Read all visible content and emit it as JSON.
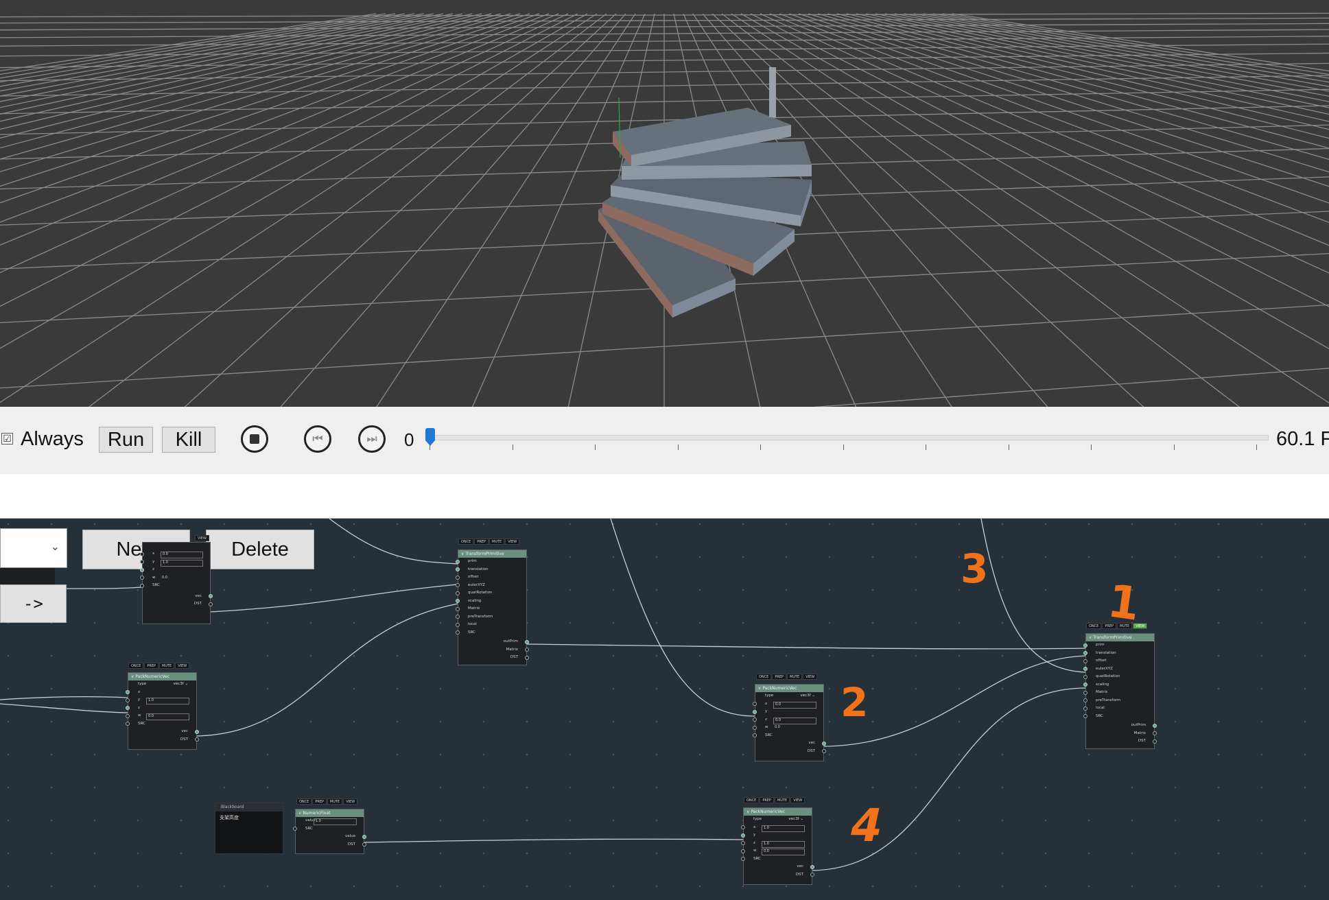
{
  "timeline": {
    "always_checked": "☑",
    "always_label": "Always",
    "run_label": "Run",
    "kill_label": "Kill",
    "frame": "0",
    "fps": "60.1 F"
  },
  "toolbar": {
    "select_value": "",
    "arrow_label": "->",
    "new_label": "New",
    "delete_label": "Delete"
  },
  "tags": [
    "ONCE",
    "PREP",
    "MUTE",
    "VIEW"
  ],
  "nodes": {
    "tp1": {
      "title": "TransformPrimitive",
      "inputs": [
        "prim",
        "translation",
        "offset",
        "eulerXYZ",
        "quatRotation",
        "scaling",
        "Matrix",
        "preTransform",
        "local",
        "SRC"
      ],
      "outputs": [
        "outPrim",
        "Matrix",
        "DST"
      ]
    },
    "tp2": {
      "title": "TransformPrimitive",
      "inputs": [
        "prim",
        "translation",
        "offset",
        "eulerXYZ",
        "quatRotation",
        "scaling",
        "Matrix",
        "preTransform",
        "local",
        "SRC"
      ],
      "outputs": [
        "outPrim",
        "Matrix",
        "DST"
      ]
    },
    "pack_top": {
      "rows": [
        "x",
        "y",
        "z",
        "w",
        "SRC"
      ],
      "x": "0.0",
      "y": "1.0",
      "w": "0.0",
      "outputs": [
        "vec",
        "DST"
      ]
    },
    "pack_mid": {
      "title": "PackNumericVec",
      "type_label": "type",
      "type_value": "vec3f",
      "rows": [
        "x",
        "y",
        "z",
        "w",
        "SRC"
      ],
      "y": "1.0",
      "w": "0.0",
      "outputs": [
        "vec",
        "DST"
      ]
    },
    "pack_right": {
      "title": "PackNumericVec",
      "type_label": "type",
      "type_value": "vec3f",
      "rows": [
        "x",
        "y",
        "z",
        "w",
        "SRC"
      ],
      "x": "0.0",
      "z": "0.0",
      "w": "0.0",
      "outputs": [
        "vec",
        "DST"
      ]
    },
    "pack_bottom": {
      "title": "PackNumericVec",
      "type_label": "type",
      "type_value": "vec3f",
      "rows": [
        "x",
        "y",
        "z",
        "w",
        "SRC"
      ],
      "x": "1.0",
      "z": "1.0",
      "w": "0.0",
      "outputs": [
        "vec",
        "DST"
      ]
    },
    "numfloat": {
      "title": "NumericFloat",
      "value_label": "value",
      "value": "1.0",
      "src": "SRC",
      "outputs": [
        "value",
        "DST"
      ]
    }
  },
  "blackboard": {
    "title": "Blackboard",
    "content": "支架高度"
  },
  "annotations": [
    "1",
    "2",
    "3",
    "4"
  ],
  "colors": {
    "header": "#6b8f7e",
    "view_active": "#57a945",
    "annotation": "#f0731c",
    "slider": "#1e78d6"
  }
}
